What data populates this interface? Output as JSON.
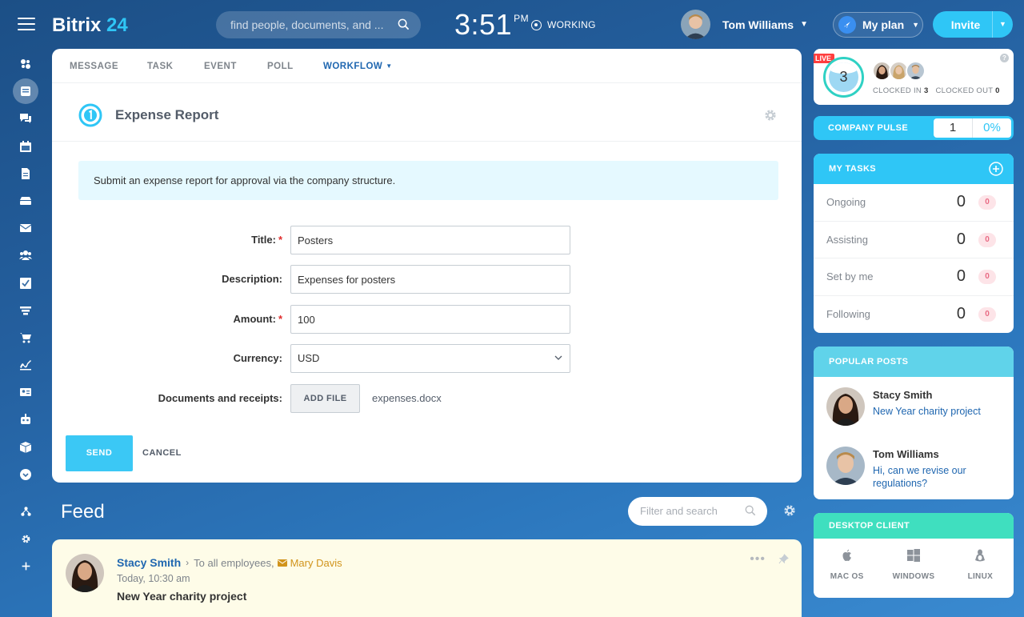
{
  "app": {
    "logo_name": "Bitrix",
    "logo_num": "24"
  },
  "header": {
    "search_placeholder": "find people, documents, and ...",
    "time": "3:51",
    "ampm": "PM",
    "status": "WORKING",
    "user_name": "Tom Williams",
    "plan_label": "My plan",
    "invite_label": "Invite"
  },
  "sidebar_icons": [
    "activity-icon",
    "feed-icon",
    "chat-icon",
    "calendar-icon",
    "documents-icon",
    "drive-icon",
    "mail-icon",
    "groups-icon",
    "tasks-icon",
    "crm-icon",
    "shop-icon",
    "sign-icon",
    "contacts-icon",
    "robot-icon",
    "box-icon",
    "more-icon",
    "structure-icon",
    "settings-icon",
    "add-icon"
  ],
  "composer": {
    "tabs": [
      "MESSAGE",
      "TASK",
      "EVENT",
      "POLL",
      "WORKFLOW"
    ],
    "active_tab": "WORKFLOW",
    "workflow_title": "Expense Report",
    "notice": "Submit an expense report for approval via the company structure.",
    "fields": {
      "title_label": "Title:",
      "title_value": "Posters",
      "description_label": "Description:",
      "description_value": "Expenses for posters",
      "amount_label": "Amount:",
      "amount_value": "100",
      "currency_label": "Currency:",
      "currency_value": "USD",
      "documents_label": "Documents and receipts:",
      "add_file_label": "ADD FILE",
      "file_name": "expenses.docx"
    },
    "send_label": "SEND",
    "cancel_label": "CANCEL"
  },
  "feed": {
    "title": "Feed",
    "search_placeholder": "Filter and search",
    "post": {
      "author": "Stacy Smith",
      "to_label": "To all employees,",
      "recipient": "Mary Davis",
      "time": "Today, 10:30 am",
      "title": "New Year charity project"
    }
  },
  "timeman": {
    "live_label": "LIVE",
    "count": "3",
    "clocked_in_label": "CLOCKED IN",
    "clocked_in_value": "3",
    "clocked_out_label": "CLOCKED OUT",
    "clocked_out_value": "0",
    "help": "?"
  },
  "pulse": {
    "label": "COMPANY PULSE",
    "value": "1",
    "percent": "0%"
  },
  "my_tasks": {
    "title": "MY TASKS",
    "rows": [
      {
        "name": "Ongoing",
        "count": "0",
        "badge": "0"
      },
      {
        "name": "Assisting",
        "count": "0",
        "badge": "0"
      },
      {
        "name": "Set by me",
        "count": "0",
        "badge": "0"
      },
      {
        "name": "Following",
        "count": "0",
        "badge": "0"
      }
    ]
  },
  "popular_posts": {
    "title": "POPULAR POSTS",
    "items": [
      {
        "name": "Stacy Smith",
        "text": "New Year charity project"
      },
      {
        "name": "Tom Williams",
        "text": "Hi, can we revise our regulations?"
      }
    ]
  },
  "desktop_client": {
    "title": "DESKTOP CLIENT",
    "items": [
      "MAC OS",
      "WINDOWS",
      "LINUX"
    ]
  },
  "colors": {
    "accent": "#2fc6f6",
    "link": "#2067b0",
    "required": "#e02d2d",
    "popular_header": "#60d3ea",
    "desktop_header": "#3fdfbf",
    "post_bg": "#fefce8"
  }
}
